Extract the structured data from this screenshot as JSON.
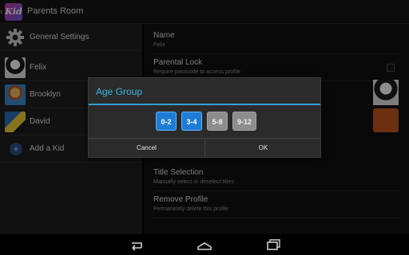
{
  "actionbar": {
    "logo_text": "Kid",
    "title": "Parents Room"
  },
  "sidebar": {
    "items": [
      {
        "label": "General Settings",
        "icon": "gear-icon"
      },
      {
        "label": "Felix",
        "icon": "avatar"
      },
      {
        "label": "Brooklyn",
        "icon": "avatar"
      },
      {
        "label": "David",
        "icon": "avatar"
      },
      {
        "label": "Add a Kid",
        "icon": "plus-circle-icon"
      }
    ]
  },
  "main": {
    "name": {
      "title": "Name",
      "value": "Felix"
    },
    "parental_lock": {
      "title": "Parental Lock",
      "subtitle": "Require passcode to access profile",
      "checked": false
    },
    "title_selection": {
      "title": "Title Selection",
      "subtitle": "Manually select or deselect titles"
    },
    "remove_profile": {
      "title": "Remove Profile",
      "subtitle": "Permanently delete this profile"
    },
    "profile_color": "#c4581c"
  },
  "dialog": {
    "title": "Age Group",
    "age_groups": [
      {
        "label": "0-2",
        "selected": true
      },
      {
        "label": "3-4",
        "selected": true
      },
      {
        "label": "5-8",
        "selected": false
      },
      {
        "label": "9-12",
        "selected": false
      }
    ],
    "cancel_label": "Cancel",
    "ok_label": "OK"
  },
  "colors": {
    "accent": "#33a0d4",
    "selected": "#1f7cd6",
    "unselected": "#8d8d8d"
  },
  "navbar": {
    "icons": [
      "back-icon",
      "home-icon",
      "recents-icon"
    ]
  }
}
